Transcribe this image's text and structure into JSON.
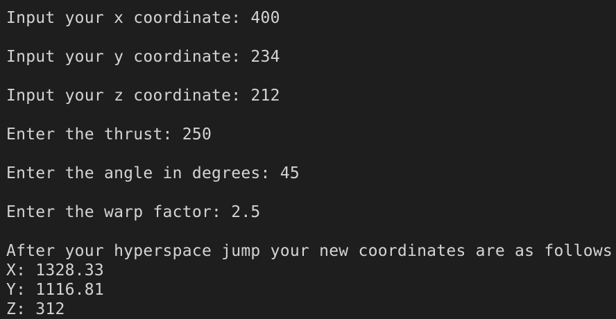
{
  "terminal": {
    "lines": [
      "Input your x coordinate: 400",
      "Input your y coordinate: 234",
      "Input your z coordinate: 212",
      "Enter the thrust: 250",
      "Enter the angle in degrees: 45",
      "Enter the warp factor: 2.5",
      "After your hyperspace jump your new coordinates are as follows",
      "X: 1328.33",
      "Y: 1116.81",
      "Z: 312"
    ]
  },
  "colors": {
    "background": "#1e1e1e",
    "text": "#d4d4d4"
  }
}
